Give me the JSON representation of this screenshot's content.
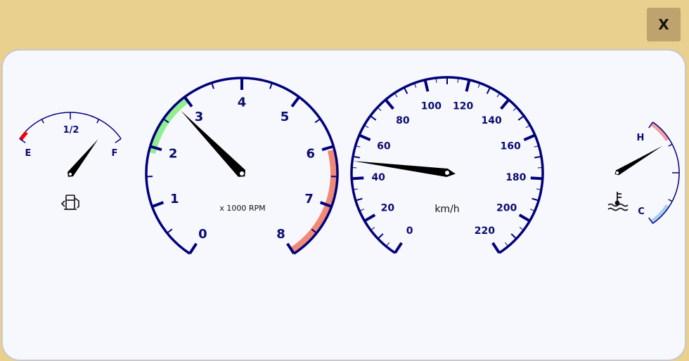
{
  "close_button": {
    "label": "X"
  },
  "colors": {
    "gauge": "#00007a",
    "needle": "#000000",
    "green_band": "#90ee90",
    "red_band": "#f08a78",
    "fuel_red": "#ff0000",
    "hot_band": "#f4a0a0",
    "cold_band": "#a7cdf2"
  },
  "fuel": {
    "empty": "E",
    "half": "1/2",
    "full": "F",
    "icon": "fuel-pump-icon",
    "level": 0.85
  },
  "tach": {
    "labels": [
      "0",
      "1",
      "2",
      "3",
      "4",
      "5",
      "6",
      "7",
      "8"
    ],
    "unit": "x 1000 RPM",
    "value": 2.8
  },
  "speed": {
    "labels": [
      "0",
      "20",
      "40",
      "60",
      "80",
      "100",
      "120",
      "140",
      "160",
      "180",
      "200",
      "220"
    ],
    "unit": "km/h",
    "value": 48
  },
  "temp": {
    "hot": "H",
    "cold": "C",
    "icon": "coolant-temperature-icon",
    "level": 0.78
  }
}
